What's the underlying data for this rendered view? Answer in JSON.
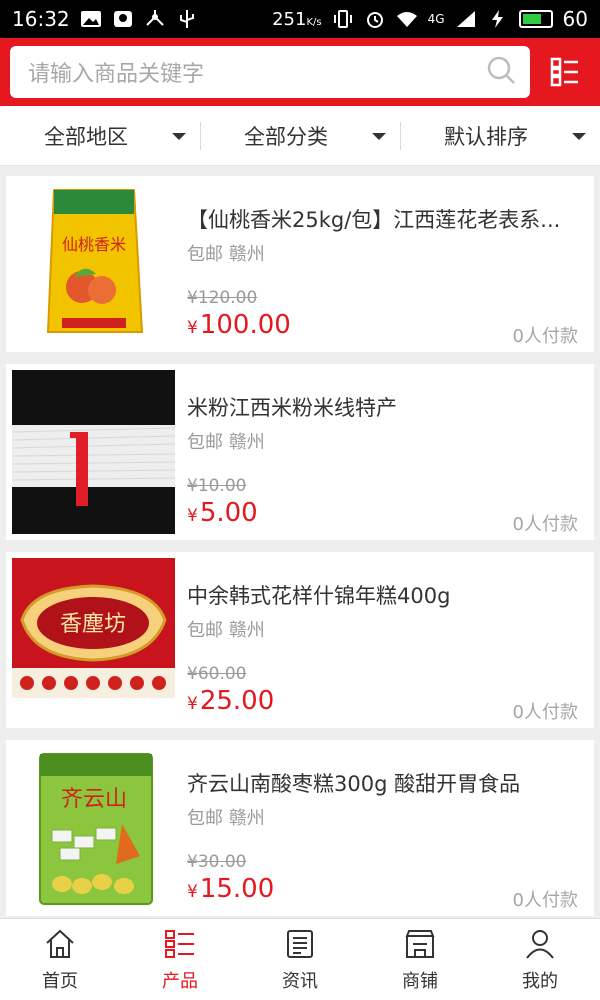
{
  "status_bar": {
    "time": "16:32",
    "speed_value": "251",
    "speed_unit": "K/s",
    "network": "4G",
    "battery_level": "60"
  },
  "search": {
    "placeholder": "请输入商品关键字",
    "icon": "search-icon",
    "menu_icon": "grid-list-icon"
  },
  "filters": [
    {
      "label": "全部地区"
    },
    {
      "label": "全部分类"
    },
    {
      "label": "默认排序"
    }
  ],
  "products": [
    {
      "title": "【仙桃香米25kg/包】江西莲花老表系...",
      "shipping": "包邮 赣州",
      "old_price": "¥120.00",
      "currency": "¥",
      "price": "100.00",
      "sales": "0人付款",
      "image_text": "仙桃香米"
    },
    {
      "title": "米粉江西米粉米线特产",
      "shipping": "包邮 赣州",
      "old_price": "¥10.00",
      "currency": "¥",
      "price": "5.00",
      "sales": "0人付款"
    },
    {
      "title": "中余韩式花样什锦年糕400g",
      "shipping": "包邮 赣州",
      "old_price": "¥60.00",
      "currency": "¥",
      "price": "25.00",
      "sales": "0人付款",
      "image_text": "香塵坊"
    },
    {
      "title": "齐云山南酸枣糕300g 酸甜开胃食品",
      "shipping": "包邮 赣州",
      "old_price": "¥30.00",
      "currency": "¥",
      "price": "15.00",
      "sales": "0人付款",
      "image_text": "齐云山"
    }
  ],
  "tabs": [
    {
      "label": "首页",
      "icon": "home-icon",
      "active": false
    },
    {
      "label": "产品",
      "icon": "list-icon",
      "active": true
    },
    {
      "label": "资讯",
      "icon": "news-icon",
      "active": false
    },
    {
      "label": "商铺",
      "icon": "store-icon",
      "active": false
    },
    {
      "label": "我的",
      "icon": "user-icon",
      "active": false
    }
  ],
  "colors": {
    "brand_red": "#e5171f",
    "price_red": "#e5171f",
    "background": "#eeeeee"
  }
}
